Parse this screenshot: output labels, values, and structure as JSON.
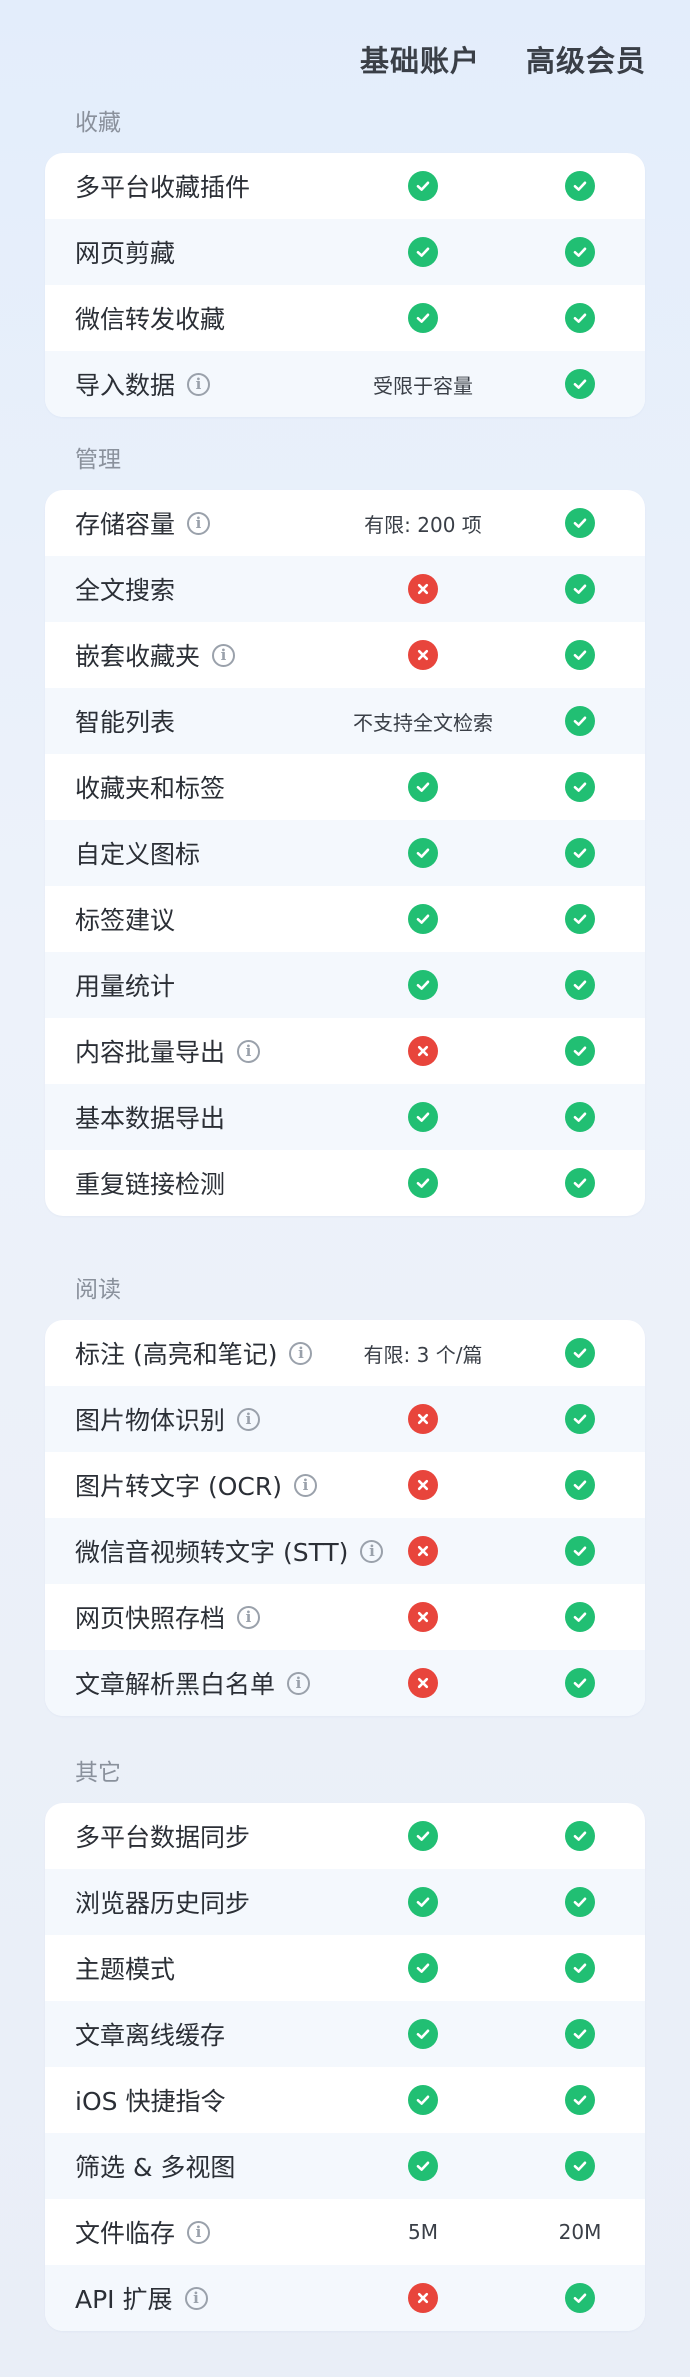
{
  "header": {
    "basic": "基础账户",
    "premium": "高级会员"
  },
  "sections": [
    {
      "title": "收藏",
      "rows": [
        {
          "label": "多平台收藏插件",
          "info": false,
          "basic": "check",
          "premium": "check"
        },
        {
          "label": "网页剪藏",
          "info": false,
          "basic": "check",
          "premium": "check"
        },
        {
          "label": "微信转发收藏",
          "info": false,
          "basic": "check",
          "premium": "check"
        },
        {
          "label": "导入数据",
          "info": true,
          "basic": "受限于容量",
          "premium": "check"
        }
      ]
    },
    {
      "title": "管理",
      "rows": [
        {
          "label": "存储容量",
          "info": true,
          "basic": "有限: 200 项",
          "premium": "check"
        },
        {
          "label": "全文搜索",
          "info": false,
          "basic": "cross",
          "premium": "check"
        },
        {
          "label": "嵌套收藏夹",
          "info": true,
          "basic": "cross",
          "premium": "check"
        },
        {
          "label": "智能列表",
          "info": false,
          "basic": "不支持全文检索",
          "premium": "check"
        },
        {
          "label": "收藏夹和标签",
          "info": false,
          "basic": "check",
          "premium": "check"
        },
        {
          "label": "自定义图标",
          "info": false,
          "basic": "check",
          "premium": "check"
        },
        {
          "label": "标签建议",
          "info": false,
          "basic": "check",
          "premium": "check"
        },
        {
          "label": "用量统计",
          "info": false,
          "basic": "check",
          "premium": "check"
        },
        {
          "label": "内容批量导出",
          "info": true,
          "basic": "cross",
          "premium": "check"
        },
        {
          "label": "基本数据导出",
          "info": false,
          "basic": "check",
          "premium": "check"
        },
        {
          "label": "重复链接检测",
          "info": false,
          "basic": "check",
          "premium": "check"
        }
      ]
    },
    {
      "title": "阅读",
      "rows": [
        {
          "label": "标注 (高亮和笔记)",
          "info": true,
          "basic": "有限: 3 个/篇",
          "premium": "check"
        },
        {
          "label": "图片物体识别",
          "info": true,
          "basic": "cross",
          "premium": "check"
        },
        {
          "label": "图片转文字 (OCR)",
          "info": true,
          "basic": "cross",
          "premium": "check"
        },
        {
          "label": "微信音视频转文字 (STT)",
          "info": true,
          "basic": "cross",
          "premium": "check"
        },
        {
          "label": "网页快照存档",
          "info": true,
          "basic": "cross",
          "premium": "check"
        },
        {
          "label": "文章解析黑白名单",
          "info": true,
          "basic": "cross",
          "premium": "check"
        }
      ]
    },
    {
      "title": "其它",
      "rows": [
        {
          "label": "多平台数据同步",
          "info": false,
          "basic": "check",
          "premium": "check"
        },
        {
          "label": "浏览器历史同步",
          "info": false,
          "basic": "check",
          "premium": "check"
        },
        {
          "label": "主题模式",
          "info": false,
          "basic": "check",
          "premium": "check"
        },
        {
          "label": "文章离线缓存",
          "info": false,
          "basic": "check",
          "premium": "check"
        },
        {
          "label": "iOS 快捷指令",
          "info": false,
          "basic": "check",
          "premium": "check"
        },
        {
          "label": "筛选 & 多视图",
          "info": false,
          "basic": "check",
          "premium": "check"
        },
        {
          "label": "文件临存",
          "info": true,
          "basic": "5M",
          "premium": "20M"
        },
        {
          "label": "API 扩展",
          "info": true,
          "basic": "cross",
          "premium": "check"
        }
      ]
    }
  ],
  "colors": {
    "check": "#21bf73",
    "cross": "#e8453c"
  },
  "icons": {
    "check": "check-circle-icon",
    "cross": "cross-circle-icon",
    "info": "info-icon"
  }
}
